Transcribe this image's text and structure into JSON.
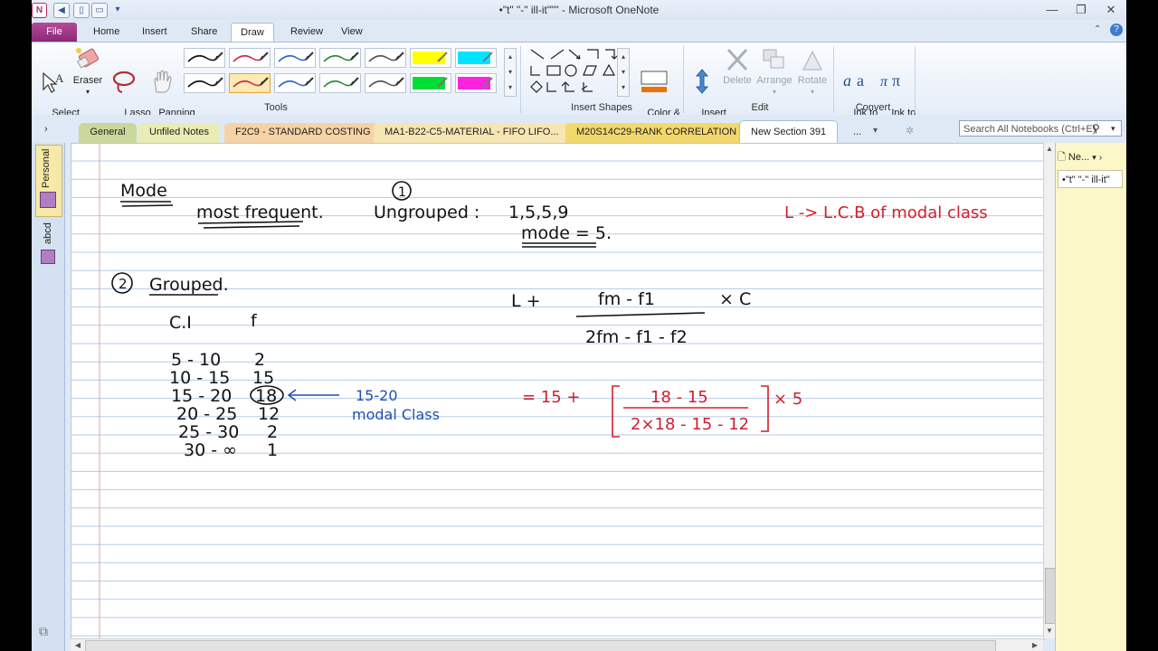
{
  "window": {
    "title": "•\"t\" \"-\" ill-it\"\"\" - Microsoft OneNote",
    "minimize": "—",
    "restore": "❐",
    "close": "✕"
  },
  "ribbon_tabs": [
    {
      "label": "File"
    },
    {
      "label": "Home"
    },
    {
      "label": "Insert"
    },
    {
      "label": "Share"
    },
    {
      "label": "Draw"
    },
    {
      "label": "Review"
    },
    {
      "label": "View"
    }
  ],
  "tools": {
    "select_type": "Select\n& Type",
    "eraser": "Eraser",
    "lasso": "Lasso\nSelect",
    "panning": "Panning\nHand",
    "group_label": "Tools"
  },
  "shapes": {
    "group_label": "Insert Shapes",
    "color_thickness": "Color &\nThickness"
  },
  "edit": {
    "insert_space": "Insert\nSpace",
    "delete": "Delete",
    "arrange": "Arrange",
    "rotate": "Rotate",
    "group_label": "Edit"
  },
  "convert": {
    "ink_to_text": "Ink to\nText",
    "ink_to_math": "Ink to\nMath",
    "group_label": "Convert"
  },
  "section_tabs": [
    {
      "label": "General",
      "color": "#c9d89a"
    },
    {
      "label": "Unfiled Notes",
      "color": "#e9ecb3"
    },
    {
      "label": "F2C9 - STANDARD COSTING",
      "color": "#f6d3a5"
    },
    {
      "label": "MA1-B22-C5-MATERIAL - FIFO LIFO...",
      "color": "#f7e5b2"
    },
    {
      "label": "M20S14C29-RANK CORRELATION",
      "color": "#f3d86b"
    },
    {
      "label": "New Section 391",
      "color": "#ffffff"
    },
    {
      "label": "...",
      "color": "#dfe9f5"
    }
  ],
  "search": {
    "placeholder": "Search All Notebooks (Ctrl+E)"
  },
  "notebook_bar": {
    "personal": "Personal",
    "abcd": "abcd"
  },
  "page_panel": {
    "new_page": "Ne...",
    "page_title": "•\"t\" \"-\" ill-it\""
  },
  "ink": {
    "mode_heading": "Mode",
    "most_frequent": "most frequent.",
    "circle_one": "1",
    "ungrouped": "Ungrouped :",
    "ungrouped_values": "1,5,5,9",
    "mode_eq": "mode = 5.",
    "l_def": "L -> L.C.B of modal class",
    "circle_two": "2",
    "grouped": "Grouped.",
    "col_ci": "C.I",
    "col_f": "f",
    "rows": [
      {
        "ci": "5 - 10",
        "f": "2"
      },
      {
        "ci": "10 - 15",
        "f": "15"
      },
      {
        "ci": "15 - 20",
        "f": "18"
      },
      {
        "ci": "20 - 25",
        "f": "12"
      },
      {
        "ci": "25 - 30",
        "f": "2"
      },
      {
        "ci": "30 - ∞",
        "f": "1"
      }
    ],
    "note_line1": "15-20",
    "note_line2": "modal Class",
    "formula_lead": "L  +",
    "formula_num": "fm - f1",
    "formula_den": "2fm - f1 - f2",
    "formula_times": "× C",
    "sub_lead": "= 15 +",
    "sub_num": "18 - 15",
    "sub_den": "2×18 - 15 - 12",
    "sub_times": "× 5"
  },
  "colors": {
    "ink_black": "#111111",
    "ink_red": "#d0202c",
    "ink_blue": "#2050b0",
    "page_rule": "#b7cbe6",
    "margin_rule": "#e0a0a0"
  }
}
